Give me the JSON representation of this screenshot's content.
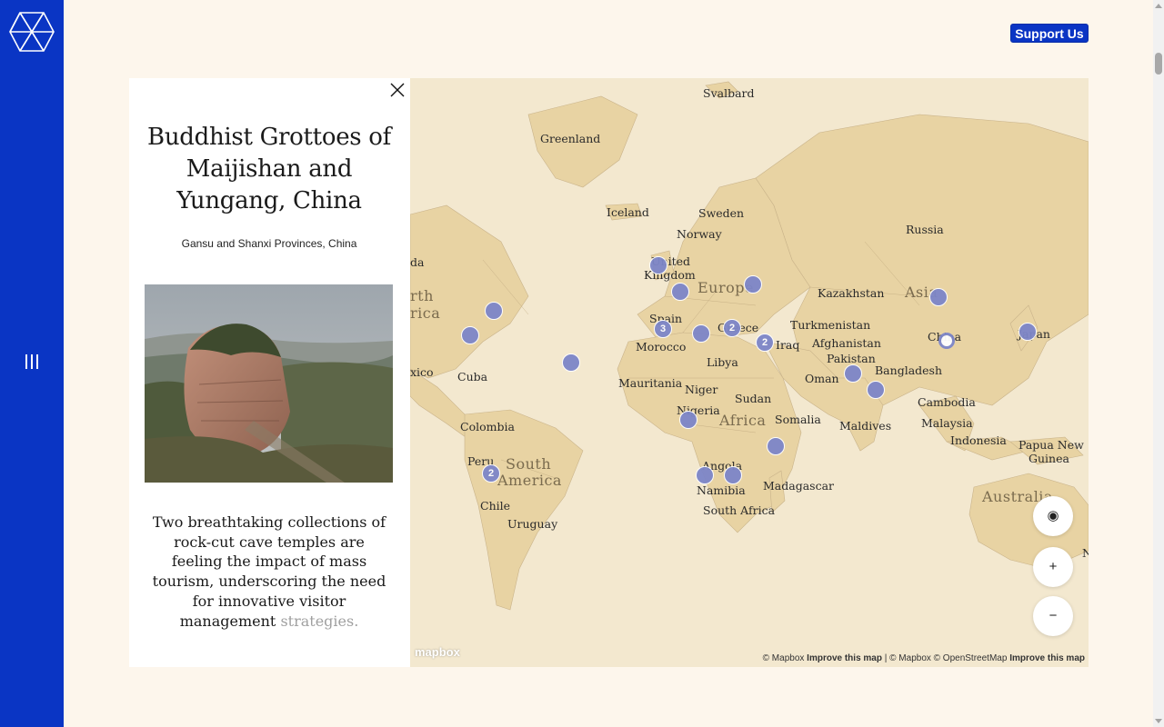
{
  "header": {
    "support_label": "Support Us"
  },
  "sidebar": {
    "logo": "lattice-logo-icon",
    "menu": "menu-icon"
  },
  "panel": {
    "title": "Buddhist Grottoes of Maijishan and Yungang, China",
    "location": "Gansu and Shanxi Provinces, China",
    "description": "Two breathtaking collections of rock-cut cave temples are feeling the impact of mass tourism, underscoring the need for innovative visitor management",
    "description_fade": "strategies."
  },
  "map": {
    "labels": {
      "svalbard": "Svalbard",
      "greenland": "Greenland",
      "iceland": "Iceland",
      "sweden": "Sweden",
      "norway": "Norway",
      "russia": "Russia",
      "united_kingdom_1": "United",
      "united_kingdom_2": "Kingdom",
      "europe": "Europe",
      "kazakhstan": "Kazakhstan",
      "asia": "Asia",
      "spain": "Spain",
      "greece": "Greece",
      "turkmenistan": "Turkmenistan",
      "afghanistan": "Afghanistan",
      "iraq": "Iraq",
      "china": "China",
      "japan": "Japan",
      "morocco": "Morocco",
      "libya": "Libya",
      "pakistan": "Pakistan",
      "oman": "Oman",
      "bangladesh": "Bangladesh",
      "mauritania": "Mauritania",
      "niger": "Niger",
      "sudan": "Sudan",
      "nigeria": "Nigeria",
      "africa": "Africa",
      "somalia": "Somalia",
      "cambodia": "Cambodia",
      "maldives": "Maldives",
      "malaysia": "Malaysia",
      "indonesia": "Indonesia",
      "papua_1": "Papua New",
      "papua_2": "Guinea",
      "angola": "Angola",
      "namibia": "Namibia",
      "madagascar": "Madagascar",
      "south_africa": "South Africa",
      "australia": "Australia",
      "canada_da": "da",
      "north_america_1": "rth",
      "north_america_2": "rica",
      "mexico": "xico",
      "cuba": "Cuba",
      "colombia": "Colombia",
      "peru": "Peru",
      "south_america_1": "South",
      "south_america_2": "America",
      "chile": "Chile",
      "uruguay": "Uruguay",
      "nz": "N"
    },
    "markers": [
      {
        "name": "east-us",
        "count": ""
      },
      {
        "name": "us-south",
        "count": ""
      },
      {
        "name": "atlantic",
        "count": ""
      },
      {
        "name": "uk",
        "count": ""
      },
      {
        "name": "france",
        "count": ""
      },
      {
        "name": "ukraine",
        "count": ""
      },
      {
        "name": "spain",
        "count": "3"
      },
      {
        "name": "italy",
        "count": ""
      },
      {
        "name": "greece",
        "count": "2"
      },
      {
        "name": "iraq",
        "count": "2"
      },
      {
        "name": "mongolia",
        "count": ""
      },
      {
        "name": "china",
        "count": ""
      },
      {
        "name": "japan",
        "count": ""
      },
      {
        "name": "india-west",
        "count": ""
      },
      {
        "name": "india-south",
        "count": ""
      },
      {
        "name": "nigeria",
        "count": ""
      },
      {
        "name": "kenya",
        "count": ""
      },
      {
        "name": "angola",
        "count": ""
      },
      {
        "name": "zambia",
        "count": ""
      },
      {
        "name": "peru",
        "count": "2"
      }
    ],
    "controls": {
      "locate": "◉",
      "zoom_in": "+",
      "zoom_out": "−"
    },
    "logo": "mapbox",
    "attribution": {
      "a1": "© Mapbox",
      "a2": "Improve this map",
      "sep": "|",
      "a3": "© Mapbox © OpenStreetMap",
      "a4": "Improve this map"
    }
  },
  "colors": {
    "brand": "#0a35c4",
    "marker": "#7d86c8",
    "page_bg": "#fdf6ec",
    "land": "#e8d3a3",
    "ocean": "#f3e8cf"
  }
}
